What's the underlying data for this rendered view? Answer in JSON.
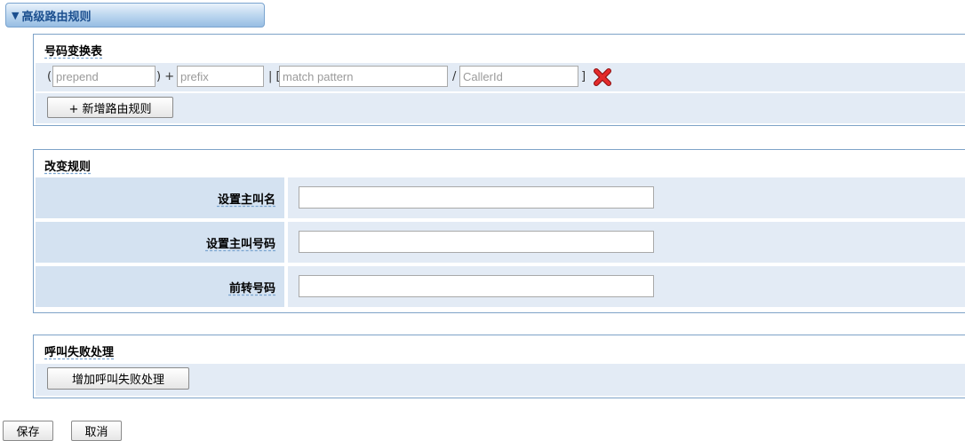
{
  "header": {
    "toggle_icon": "triangle-down-icon",
    "title": "高级路由规则"
  },
  "number_table": {
    "title": "号码变换表",
    "open_paren": "(",
    "plus": ") +",
    "pipe": "| [",
    "slash": "/",
    "close_bracket": "]",
    "prepend_placeholder": "prepend",
    "prefix_placeholder": "prefix",
    "match_placeholder": "match pattern",
    "callerid_placeholder": "CallerId",
    "delete_icon": "red-x-delete-icon",
    "add_rule_label": "+ 新增路由规则"
  },
  "change_rules": {
    "title": "改变规则",
    "fields": [
      {
        "label": "设置主叫名",
        "value": ""
      },
      {
        "label": "设置主叫号码",
        "value": ""
      },
      {
        "label": "前转号码",
        "value": ""
      }
    ]
  },
  "fail_handling": {
    "title": "呼叫失败处理",
    "add_label": "增加呼叫失败处理"
  },
  "actions": {
    "save_label": "保存",
    "cancel_label": "取消"
  }
}
